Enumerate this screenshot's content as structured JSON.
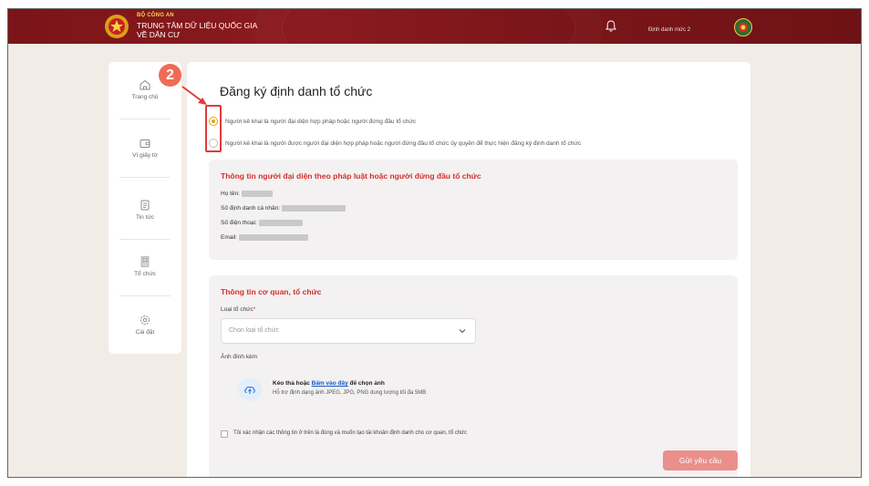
{
  "header": {
    "org_small": "BỘ CÔNG AN",
    "org_line1": "TRUNG TÂM DỮ LIỆU QUỐC GIA",
    "org_line2": "VỀ DÂN CƯ",
    "user_level": "Định danh mức 2",
    "icons": [
      "national-emblem-icon",
      "bell-icon",
      "avatar-icon"
    ]
  },
  "sidebar": {
    "items": [
      {
        "label": "Trang chủ",
        "icon": "home-icon"
      },
      {
        "label": "Ví giấy tờ",
        "icon": "wallet-icon"
      },
      {
        "label": "Tin tức",
        "icon": "news-icon"
      },
      {
        "label": "Tổ chức",
        "icon": "building-icon"
      },
      {
        "label": "Cài đặt",
        "icon": "gear-icon"
      }
    ]
  },
  "annotation": {
    "step": "2"
  },
  "page": {
    "title": "Đăng ký định danh tổ chức",
    "options": [
      {
        "label": "Người kê khai là người đại diện hợp pháp hoặc người đứng đầu tổ chức",
        "selected": true
      },
      {
        "label": "Người kê khai là người được người đại diện hợp pháp hoặc người đứng đầu tổ chức ủy quyền để thực hiện đăng ký định danh tổ chức",
        "selected": false
      }
    ],
    "rep_section": {
      "title": "Thông tin người đại diện theo pháp luật hoặc người đứng đầu tổ chức",
      "name_label": "Họ tên:",
      "id_label": "Số định danh cá nhân:",
      "phone_label": "Số điện thoại:",
      "email_label": "Email:"
    },
    "org_section": {
      "title": "Thông tin cơ quan, tổ chức",
      "org_type_label": "Loại tổ chức",
      "required_mark": "*",
      "org_type_placeholder": "Chọn loại tổ chức",
      "attachment_label": "Ảnh đính kèm",
      "upload_prefix": "Kéo thả hoặc ",
      "upload_link": "Bấm vào đây",
      "upload_suffix": " để chọn ảnh",
      "upload_hint": "Hỗ trợ định dạng ảnh JPEG, JPG, PNG dung lượng tối đa 5MB",
      "confirm_text": "Tôi xác nhận các thông tin ở trên là đúng và muốn tạo tài khoản định danh cho cơ quan, tổ chức",
      "submit_label": "Gửi yêu cầu"
    }
  },
  "colors": {
    "header_bg": "#7a1418",
    "accent_red": "#d5302f",
    "radio_selected": "#e6a800",
    "submit_bg": "#ea8f8b",
    "badge_bg": "#ef6b58",
    "highlight_border": "#e23a3a"
  }
}
